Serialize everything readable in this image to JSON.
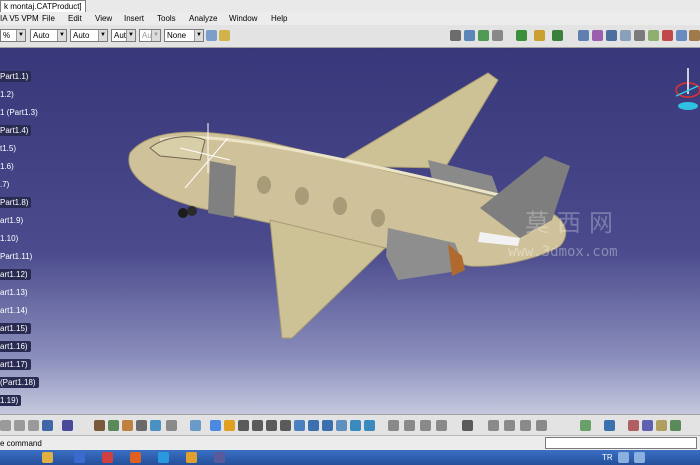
{
  "window": {
    "title": "k montaj.CATProduct]"
  },
  "menu": {
    "app_label": "IA V5 VPM",
    "items": [
      "File",
      "Edit",
      "View",
      "Insert",
      "Tools",
      "Analyze",
      "Window",
      "Help"
    ]
  },
  "toolbar_top": {
    "zoom_combo": "%",
    "combo_a": "Auto",
    "combo_b": "Auto",
    "combo_c": "Aut",
    "combo_d": "Aut",
    "combo_e": "None"
  },
  "tree": {
    "items": [
      "Part1.1)",
      "1.2)",
      "1 (Part1.3)",
      "Part1.4)",
      "t1.5)",
      "1.6)",
      ".7)",
      "Part1.8)",
      "art1.9)",
      "1.10)",
      "Part1.11)",
      "art1.12)",
      "art1.13)",
      "art1.14)",
      "art1.15)",
      "art1.16)",
      "art1.17)",
      "(Part1.18)",
      "1.19)"
    ]
  },
  "watermark": {
    "cn": "莫西网",
    "url": "www.3dmox.com"
  },
  "statusbar": {
    "command_label": "e command"
  },
  "taskbar": {
    "language": "TR"
  },
  "colors": {
    "viewport_top": "#38377a",
    "viewport_bottom": "#c7c9de",
    "fuselage": "#cfc29a",
    "engine": "#8c8c8c"
  }
}
